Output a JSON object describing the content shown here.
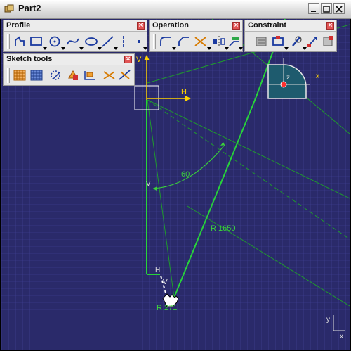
{
  "window": {
    "title": "Part2"
  },
  "toolbars": {
    "profile": {
      "title": "Profile"
    },
    "operation": {
      "title": "Operation"
    },
    "constraint": {
      "title": "Constraint"
    },
    "sketch_tools": {
      "title": "Sketch tools"
    },
    "close_glyph": "×"
  },
  "sketch": {
    "axis_h_label": "H",
    "axis_v_label": "V",
    "compass_z_label": "z",
    "compass_x_label": "x",
    "angle_label": "60",
    "radius_long_label": "R 1650",
    "radius_short_label": "R 271",
    "vertical_marker_1": "V",
    "vertical_marker_2": "V",
    "horizontal_marker": "H",
    "corner_axis_x": "x",
    "corner_axis_y": "y"
  },
  "colors": {
    "background": "#2a2a6a",
    "grid": "#4a4a9a",
    "geometry": "#27d33a",
    "axis": "#ffd200",
    "dimension": "#3ad23a"
  }
}
